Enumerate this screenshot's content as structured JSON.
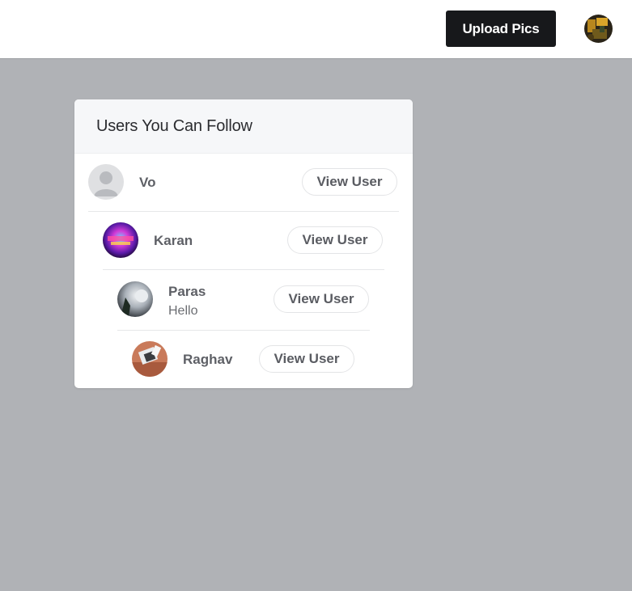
{
  "header": {
    "upload_label": "Upload Pics"
  },
  "card": {
    "title": "Users You Can Follow",
    "users": [
      {
        "name": "Vo",
        "bio": "",
        "button_label": "View User",
        "avatar": "default-person-icon"
      },
      {
        "name": "Karan",
        "bio": "",
        "button_label": "View User",
        "avatar": "photo"
      },
      {
        "name": "Paras",
        "bio": "Hello",
        "button_label": "View User",
        "avatar": "photo"
      },
      {
        "name": "Raghav",
        "bio": "",
        "button_label": "View User",
        "avatar": "photo"
      }
    ]
  },
  "colors": {
    "page_background": "#b0b2b6",
    "upload_button": "#17181b",
    "card_header": "#f6f7f9"
  }
}
